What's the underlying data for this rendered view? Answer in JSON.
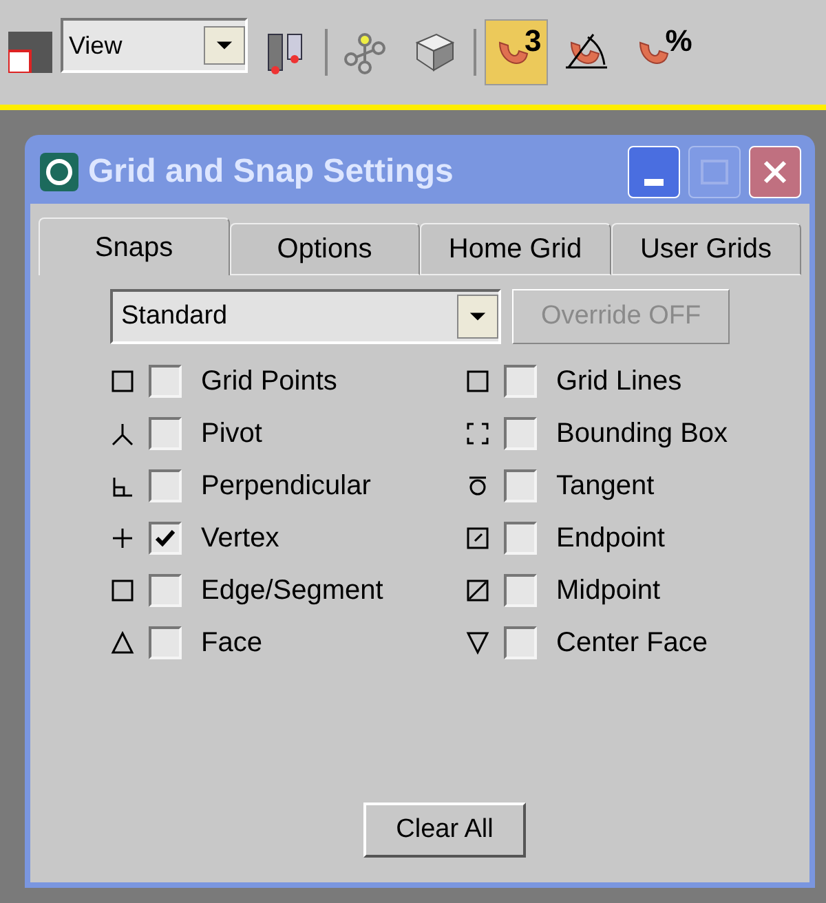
{
  "toolbar": {
    "view_select": {
      "value": "View"
    },
    "tools": [
      {
        "kind": "layers",
        "selected": false
      },
      {
        "kind": "axis",
        "selected": false
      },
      {
        "kind": "box",
        "selected": false
      },
      {
        "kind": "snap",
        "label": "3",
        "selected": true
      },
      {
        "kind": "angle-snap",
        "selected": false
      },
      {
        "kind": "percent-snap",
        "label": "%",
        "selected": false
      }
    ]
  },
  "window": {
    "title": "Grid and Snap Settings"
  },
  "tabs": [
    {
      "label": "Snaps",
      "selected": true
    },
    {
      "label": "Options",
      "selected": false
    },
    {
      "label": "Home Grid",
      "selected": false
    },
    {
      "label": "User Grids",
      "selected": false
    }
  ],
  "snap_type_select": {
    "value": "Standard"
  },
  "override_button": {
    "label": "Override OFF",
    "disabled": true
  },
  "snaps": [
    {
      "kind": "grid-points",
      "label": "Grid Points",
      "checked": false
    },
    {
      "kind": "grid-lines",
      "label": "Grid Lines",
      "checked": false
    },
    {
      "kind": "pivot",
      "label": "Pivot",
      "checked": false
    },
    {
      "kind": "bounding-box",
      "label": "Bounding Box",
      "checked": false
    },
    {
      "kind": "perpendicular",
      "label": "Perpendicular",
      "checked": false
    },
    {
      "kind": "tangent",
      "label": "Tangent",
      "checked": false
    },
    {
      "kind": "vertex",
      "label": "Vertex",
      "checked": true
    },
    {
      "kind": "endpoint",
      "label": "Endpoint",
      "checked": false
    },
    {
      "kind": "edge",
      "label": "Edge/Segment",
      "checked": false
    },
    {
      "kind": "midpoint",
      "label": "Midpoint",
      "checked": false
    },
    {
      "kind": "face",
      "label": "Face",
      "checked": false
    },
    {
      "kind": "center-face",
      "label": "Center Face",
      "checked": false
    }
  ],
  "clear_button": {
    "label": "Clear All"
  }
}
